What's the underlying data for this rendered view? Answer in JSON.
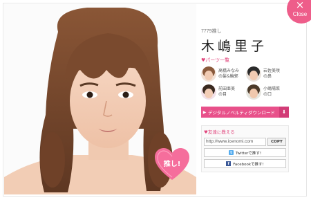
{
  "close": {
    "icon": "close-icon",
    "x_glyph": "×",
    "label": "Close"
  },
  "member": {
    "votes": "7779推し",
    "name": "木嶋里子"
  },
  "oshi_button": {
    "label": "推し!"
  },
  "parts": {
    "title": "♥パーツ一覧",
    "items": [
      {
        "label_line1": "高橋みなみ",
        "label_line2": "の髪&輪郭",
        "thumb_color": "#8a5a3c"
      },
      {
        "label_line1": "岩佐美咲",
        "label_line2": "の鼻",
        "thumb_color": "#2b2b2b"
      },
      {
        "label_line1": "前田亜美",
        "label_line2": "の目",
        "thumb_color": "#3a2a20"
      },
      {
        "label_line1": "小嶋陽菜",
        "label_line2": "の口",
        "thumb_color": "#4b3a2a"
      }
    ]
  },
  "download": {
    "label": "デジタルノベルティダウンロード",
    "arrow_glyph": "▶",
    "icon": "download-icon",
    "icon_glyph": "⬇"
  },
  "share": {
    "title": "♥友達に教える",
    "url_value": "http://www.icenomi.com",
    "copy_label": "COPY",
    "twitter_label": "Twitterで推す!",
    "facebook_label": "Facebookで推す!",
    "twitter_glyph": "t",
    "facebook_glyph": "f"
  },
  "colors": {
    "accent_pink": "#e8508a",
    "close_pink": "#ee5d8a"
  }
}
